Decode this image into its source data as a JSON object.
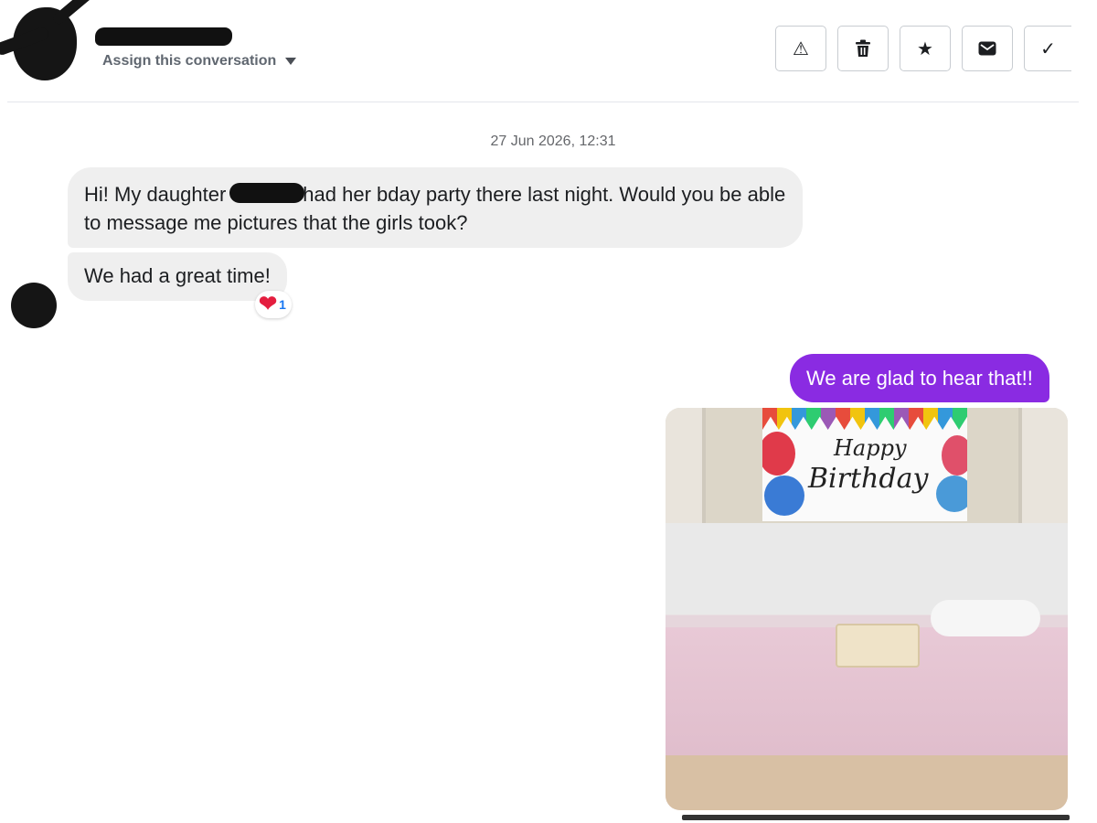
{
  "header": {
    "assign_label": "Assign this conversation",
    "toolbar": [
      {
        "name": "report-button",
        "icon": "warning-icon",
        "glyph": "⚠"
      },
      {
        "name": "delete-button",
        "icon": "trash-icon",
        "glyph": "🗑"
      },
      {
        "name": "star-button",
        "icon": "star-icon",
        "glyph": "★"
      },
      {
        "name": "mark-unread-button",
        "icon": "envelope-icon",
        "glyph": "✉"
      },
      {
        "name": "mark-done-button",
        "icon": "check-icon",
        "glyph": "✓"
      }
    ]
  },
  "conversation": {
    "timestamp": "27 Jun 2026, 12:31",
    "incoming": [
      {
        "text_before": "Hi! My daughter",
        "text_after": "had her bday party there last night. Would you be able to message me pictures that the girls took?"
      },
      {
        "text": "We had a great time!",
        "reaction": {
          "emoji": "heart",
          "count": "1"
        }
      }
    ],
    "outgoing": [
      {
        "text": "We are glad to hear that!!"
      }
    ],
    "photo": {
      "banner_line1": "Happy",
      "banner_line2": "Birthday"
    }
  },
  "colors": {
    "outgoing_bubble": "#8a2be2",
    "incoming_bubble": "#efefef",
    "reaction_count": "#1877f2",
    "heart": "#e41e3f"
  }
}
